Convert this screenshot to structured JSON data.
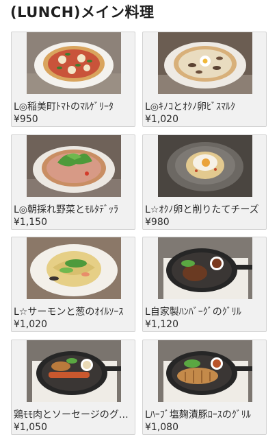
{
  "page_title": "(LUNCH)メイン料理",
  "items": [
    {
      "name": "L◎稲美町ﾄﾏﾄのﾏﾙｹﾞﾘｰﾀ",
      "price": "¥950",
      "photo": "pizza-margherita-photo"
    },
    {
      "name": "L◎ｷﾉｺとｵｸﾉ卵ﾋﾞｽﾏﾙｸ",
      "price": "¥1,020",
      "photo": "pizza-bismarck-photo"
    },
    {
      "name": "L◎朝採れ野菜とﾓﾙﾀﾃﾞｯﾗ",
      "price": "¥1,150",
      "photo": "pizza-vegetable-photo"
    },
    {
      "name": "L☆ｵｸﾉ卵と削りたてチーズ",
      "price": "¥980",
      "photo": "pasta-carbonara-photo"
    },
    {
      "name": "L☆サーモンと葱のｵｲﾙｿｰｽ",
      "price": "¥1,020",
      "photo": "pasta-salmon-photo"
    },
    {
      "name": "L自家製ﾊﾝﾊﾞｰｸﾞのｸﾞﾘﾙ",
      "price": "¥1,120",
      "photo": "hamburg-skillet-photo"
    },
    {
      "name": "鶏ﾓﾓ肉とソーセージのグリル",
      "price": "¥1,050",
      "photo": "chicken-sausage-skillet-photo"
    },
    {
      "name": "Lﾊｰﾌﾞ塩麹漬豚ﾛｰｽのｸﾞﾘﾙ",
      "price": "¥1,080",
      "photo": "pork-loin-skillet-photo"
    }
  ]
}
